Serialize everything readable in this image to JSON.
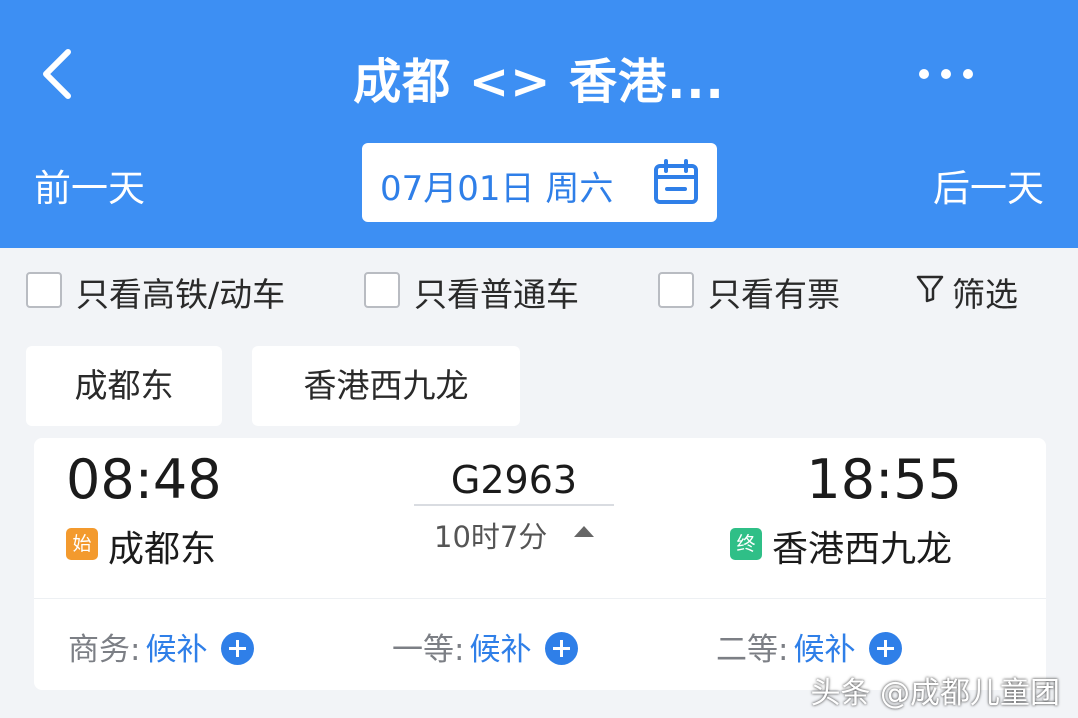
{
  "colors": {
    "header_bg": "#3d8ff3",
    "accent": "#2f7fe8",
    "start_badge": "#f39a2e",
    "end_badge": "#2fbf87",
    "page_bg": "#f2f4f7"
  },
  "header": {
    "back_icon": "chevron-left-icon",
    "title": "成都 <> 香港...",
    "more_icon": "more-horizontal-icon",
    "prev_day": "前一天",
    "next_day": "后一天",
    "date": "07月01日 周六",
    "calendar_icon": "calendar-icon"
  },
  "filters": {
    "items": [
      {
        "label": "只看高铁/动车",
        "checked": false
      },
      {
        "label": "只看普通车",
        "checked": false
      },
      {
        "label": "只看有票",
        "checked": false
      }
    ],
    "filter_button": {
      "icon": "funnel-icon",
      "label": "筛选"
    }
  },
  "stations": {
    "from": "成都东",
    "to": "香港西九龙"
  },
  "train": {
    "departure_time": "08:48",
    "arrival_time": "18:55",
    "train_no": "G2963",
    "duration": "10时7分",
    "start_badge": "始",
    "end_badge": "终",
    "departure_station": "成都东",
    "arrival_station": "香港西九龙",
    "seats": [
      {
        "class": "商务:",
        "status": "候补"
      },
      {
        "class": "一等:",
        "status": "候补"
      },
      {
        "class": "二等:",
        "status": "候补"
      }
    ]
  },
  "watermark": "头条 @成都儿童团"
}
